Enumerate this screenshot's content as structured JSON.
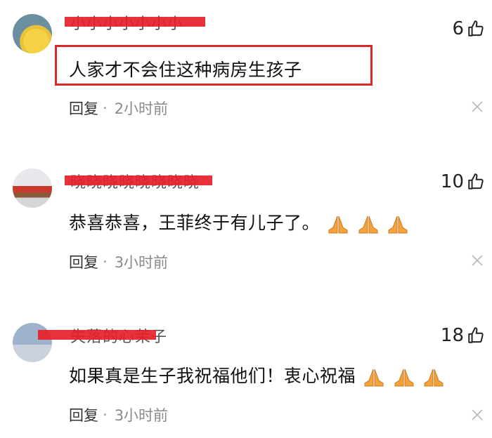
{
  "comments": [
    {
      "username": "小小小小小小小",
      "likes": "6",
      "text": "人家才不会住这种病房生孩子",
      "reply": "回复",
      "dot": "·",
      "time": "2小时前",
      "highlighted": true
    },
    {
      "username": "晓晓晓晓晓晓晓晓",
      "likes": "10",
      "text": "恭喜恭喜，王菲终于有儿子了。",
      "emoji_count": 3,
      "reply": "回复",
      "dot": "·",
      "time": "3小时前"
    },
    {
      "username": "失落的心茉子",
      "likes": "18",
      "text": "如果真是生子我祝福他们！衷心祝福",
      "emoji_count": 3,
      "reply": "回复",
      "dot": "·",
      "time": "3小时前"
    }
  ],
  "icons": {
    "like": "thumbs-up-icon",
    "close": "close-icon",
    "emoji": "folded-hands-emoji"
  },
  "colors": {
    "redaction": "#e6202a",
    "highlight_border": "#d8282a"
  }
}
